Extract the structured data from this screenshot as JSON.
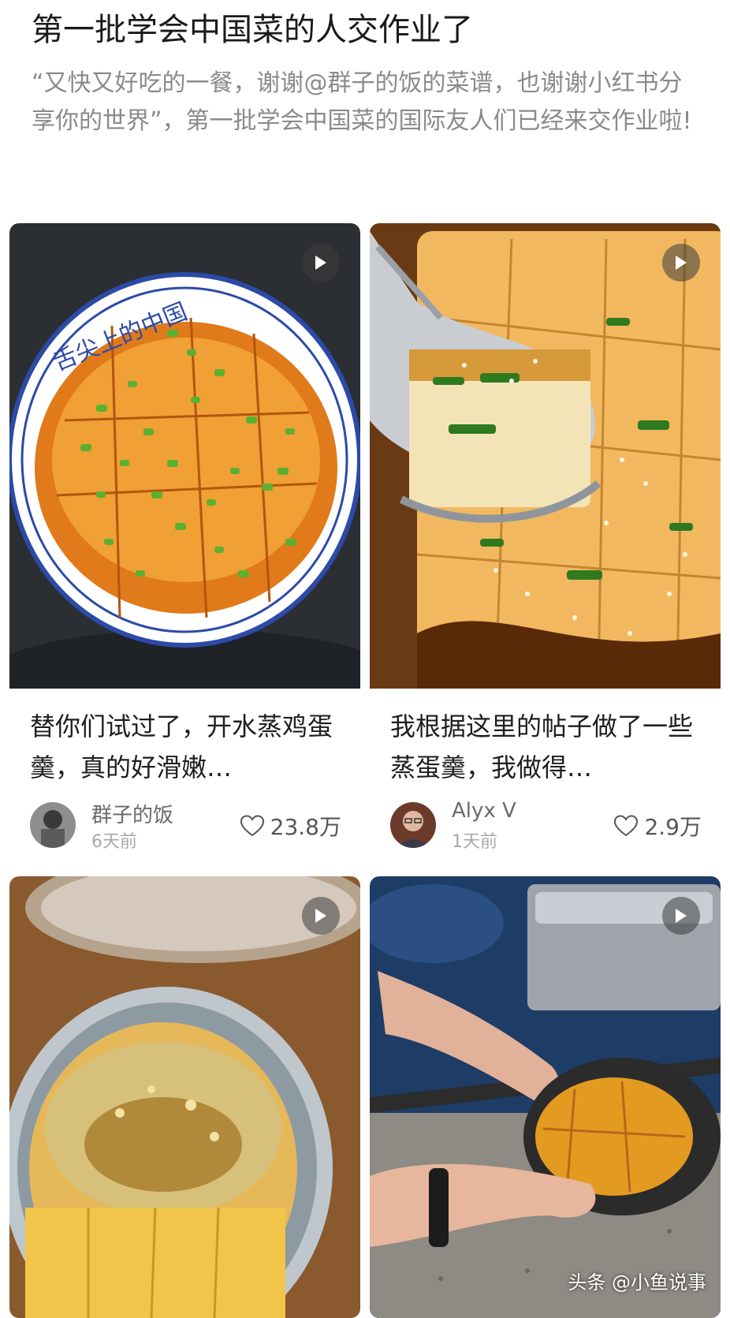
{
  "post": {
    "title": "第一批学会中国菜的人交作业了",
    "intro": "“又快又好吃的一餐，谢谢@群子的饭的菜谱，也谢谢小红书分享你的世界”，第一批学会中国菜的国际友人们已经来交作业啦!"
  },
  "cards": [
    {
      "caption": "替你们试过了，开水蒸鸡蛋羹，真的好滑嫩…",
      "author": "群子的饭",
      "time": "6天前",
      "likes": "23.8万",
      "bowl_text": "舌尖上的中国"
    },
    {
      "caption": "我根据这里的帖子做了一些蒸蛋羹，我做得…",
      "author": "Alyx V",
      "time": "1天前",
      "likes": "2.9万"
    },
    {},
    {}
  ],
  "watermark": "头条 @小鱼说事",
  "icons": {
    "play": "play-icon",
    "like": "heart-icon"
  },
  "colors": {
    "text": "#1a1a1a",
    "muted": "#8a8a8a",
    "egg": "#e8962a",
    "soy": "#8a3a0a"
  }
}
